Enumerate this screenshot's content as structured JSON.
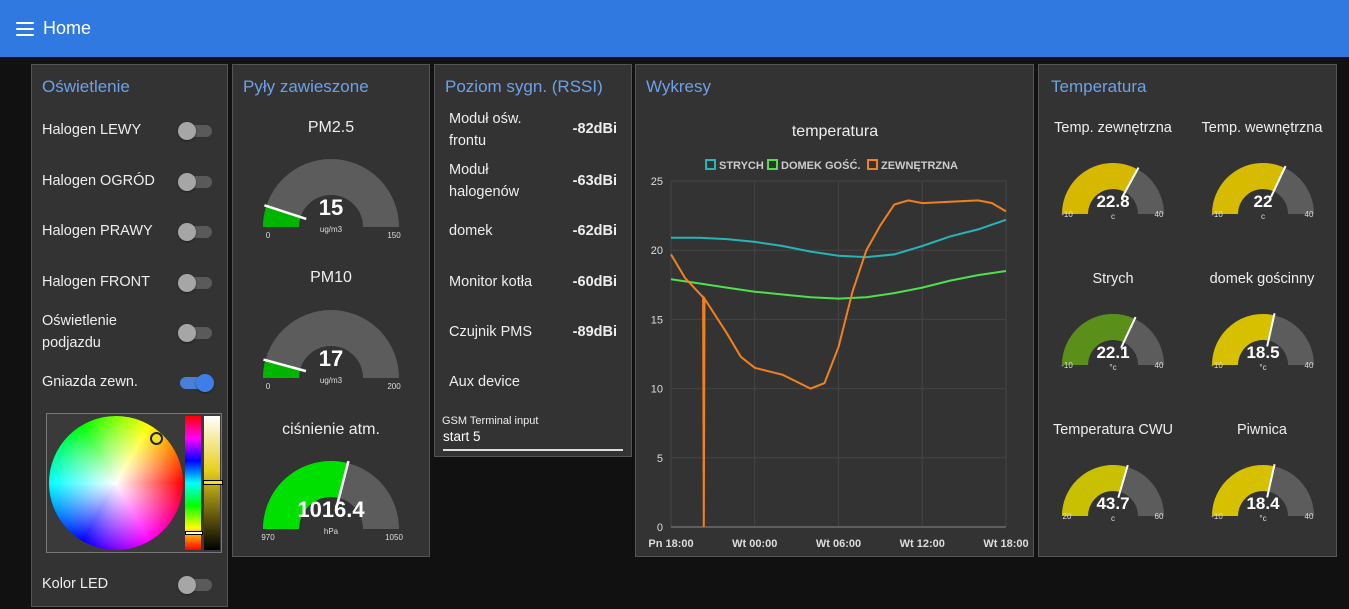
{
  "header": {
    "title": "Home",
    "menu_icon": "hamburger-menu-icon"
  },
  "lighting": {
    "title": "Oświetlenie",
    "switches": [
      {
        "label": "Halogen LEWY",
        "on": false
      },
      {
        "label": "Halogen OGRÓD",
        "on": false
      },
      {
        "label": "Halogen PRAWY",
        "on": false
      },
      {
        "label": "Halogen FRONT",
        "on": false
      },
      {
        "label": "Oświetlenie podjazdu",
        "on": false
      },
      {
        "label": "Gniazda zewn.",
        "on": true
      }
    ],
    "led": {
      "label": "Kolor LED",
      "on": false
    }
  },
  "dust": {
    "title": "Pyły zawieszone",
    "gauges": [
      {
        "title": "PM2.5",
        "value": "15",
        "unit": "ug/m3",
        "min": "0",
        "max": "150",
        "fraction": 0.1,
        "color": "#00b500"
      },
      {
        "title": "PM10",
        "value": "17",
        "unit": "ug/m3",
        "min": "0",
        "max": "200",
        "fraction": 0.085,
        "color": "#00b500"
      },
      {
        "title": "ciśnienie atm.",
        "value": "1016.4",
        "unit": "hPa",
        "min": "970",
        "max": "1050",
        "fraction": 0.58,
        "color": "#00e000"
      }
    ]
  },
  "rssi": {
    "title": "Poziom sygn. (RSSI)",
    "rows": [
      {
        "label": "Moduł ośw. frontu",
        "value": "-82dBi"
      },
      {
        "label": "Moduł halogenów",
        "value": "-63dBi"
      },
      {
        "label": "domek",
        "value": "-62dBi"
      },
      {
        "label": "Monitor kotła",
        "value": "-60dBi"
      },
      {
        "label": "Czujnik PMS",
        "value": "-89dBi"
      },
      {
        "label": "Aux device",
        "value": ""
      }
    ],
    "terminal": {
      "label": "GSM Terminal input",
      "value": "start 5"
    }
  },
  "charts": {
    "title": "Wykresy",
    "chart_data": {
      "type": "line",
      "title": "temperatura",
      "x": [
        "Pn 18:00",
        "Wt 00:00",
        "Wt 06:00",
        "Wt 12:00",
        "Wt 18:00"
      ],
      "ylim": [
        0,
        25
      ],
      "yticks": [
        "0",
        "5",
        "10",
        "15",
        "20",
        "25"
      ],
      "grid": true,
      "legend_position": "top",
      "series": [
        {
          "name": "STRYCH",
          "color": "#26b5b5",
          "values": [
            [
              0,
              20.9
            ],
            [
              2,
              20.9
            ],
            [
              4,
              20.8
            ],
            [
              6,
              20.6
            ],
            [
              8,
              20.3
            ],
            [
              10,
              19.9
            ],
            [
              12,
              19.6
            ],
            [
              14,
              19.5
            ],
            [
              16,
              19.7
            ],
            [
              18,
              20.3
            ],
            [
              20,
              21.0
            ],
            [
              22,
              21.5
            ],
            [
              24,
              22.2
            ]
          ]
        },
        {
          "name": "DOMEK GOŚĆ.",
          "color": "#4ee04e",
          "values": [
            [
              0,
              17.9
            ],
            [
              2,
              17.6
            ],
            [
              4,
              17.3
            ],
            [
              6,
              17.0
            ],
            [
              8,
              16.8
            ],
            [
              10,
              16.6
            ],
            [
              12,
              16.5
            ],
            [
              14,
              16.6
            ],
            [
              16,
              16.9
            ],
            [
              18,
              17.3
            ],
            [
              20,
              17.8
            ],
            [
              22,
              18.2
            ],
            [
              24,
              18.5
            ]
          ]
        },
        {
          "name": "ZEWNĘTRZNA",
          "color": "#f08020",
          "values": [
            [
              0,
              19.7
            ],
            [
              1,
              18.0
            ],
            [
              2.3,
              16.6
            ],
            [
              2.35,
              0.0
            ],
            [
              2.4,
              16.5
            ],
            [
              4,
              14.0
            ],
            [
              5,
              12.3
            ],
            [
              6,
              11.5
            ],
            [
              8,
              11.0
            ],
            [
              10,
              10.0
            ],
            [
              11,
              10.4
            ],
            [
              12,
              13.0
            ],
            [
              13,
              17.0
            ],
            [
              14,
              20.0
            ],
            [
              15,
              21.8
            ],
            [
              16,
              23.3
            ],
            [
              17,
              23.6
            ],
            [
              18,
              23.4
            ],
            [
              20,
              23.5
            ],
            [
              22,
              23.6
            ],
            [
              23,
              23.4
            ],
            [
              24,
              22.8
            ]
          ]
        }
      ]
    }
  },
  "temperature": {
    "title": "Temperatura",
    "gauges": [
      {
        "title": "Temp. zewnętrzna",
        "value": "22.8",
        "unit": "c",
        "min": "-10",
        "max": "40",
        "fraction": 0.66,
        "color": "#d6b800"
      },
      {
        "title": "Temp. wewnętrzna",
        "value": "22",
        "unit": "c",
        "min": "-10",
        "max": "40",
        "fraction": 0.64,
        "color": "#d6bb00"
      },
      {
        "title": "Strych",
        "value": "22.1",
        "unit": "°c",
        "min": "-10",
        "max": "40",
        "fraction": 0.64,
        "color": "#5a8f1a"
      },
      {
        "title": "domek gościnny",
        "value": "18.5",
        "unit": "°c",
        "min": "-10",
        "max": "40",
        "fraction": 0.57,
        "color": "#d6c000"
      },
      {
        "title": "Temperatura CWU",
        "value": "43.7",
        "unit": "c",
        "min": "20",
        "max": "60",
        "fraction": 0.59,
        "color": "#c8c000"
      },
      {
        "title": "Piwnica",
        "value": "18.4",
        "unit": "°c",
        "min": "-10",
        "max": "40",
        "fraction": 0.57,
        "color": "#d6c000"
      }
    ]
  }
}
